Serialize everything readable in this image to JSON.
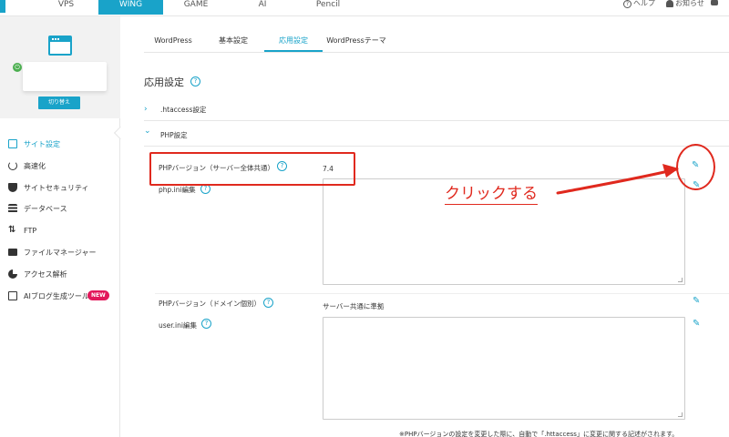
{
  "topnav": {
    "tabs": [
      {
        "label": "VPS",
        "active": false
      },
      {
        "label": "WING",
        "active": true
      },
      {
        "label": "GAME",
        "active": false
      },
      {
        "label": "AI",
        "active": false
      },
      {
        "label": "Pencil",
        "active": false
      }
    ],
    "help_label": "ヘルプ",
    "notice_label": "お知らせ",
    "accent_color": "#19a3c9"
  },
  "sidebar": {
    "switch_button": "切り替え",
    "items": [
      {
        "label": "サイト設定",
        "icon": "site-settings-icon",
        "active": true
      },
      {
        "label": "高速化",
        "icon": "speed-icon"
      },
      {
        "label": "サイトセキュリティ",
        "icon": "shield-icon"
      },
      {
        "label": "データベース",
        "icon": "database-icon"
      },
      {
        "label": "FTP",
        "icon": "ftp-icon"
      },
      {
        "label": "ファイルマネージャー",
        "icon": "folder-icon"
      },
      {
        "label": "アクセス解析",
        "icon": "pie-chart-icon"
      },
      {
        "label": "AIブログ生成ツール",
        "icon": "document-icon",
        "badge": "NEW"
      }
    ],
    "badge_color": "#e2185b"
  },
  "tabs": [
    {
      "label": "WordPress"
    },
    {
      "label": "基本設定"
    },
    {
      "label": "応用設定",
      "active": true
    },
    {
      "label": "WordPressテーマ"
    }
  ],
  "page": {
    "title": "応用設定",
    "sections": [
      {
        "title": ".htaccess設定",
        "expanded": false,
        "chevron": "›"
      },
      {
        "title": "PHP設定",
        "expanded": true,
        "chevron": "⌄"
      }
    ],
    "php_version_label": "PHPバージョン（サーバー全体共通）",
    "php_version_value": "7.4",
    "php_ini_label": "php.ini編集",
    "php_domain_label": "PHPバージョン（ドメイン個別）",
    "php_domain_value": "サーバー共通に準拠",
    "user_ini_label": "user.ini編集",
    "note": "※PHPバージョンの設定を変更した際に、自動で「.httaccess」に変更に関する記述がされます。"
  },
  "annotation": {
    "text": "クリックする",
    "color": "#e0291e"
  }
}
